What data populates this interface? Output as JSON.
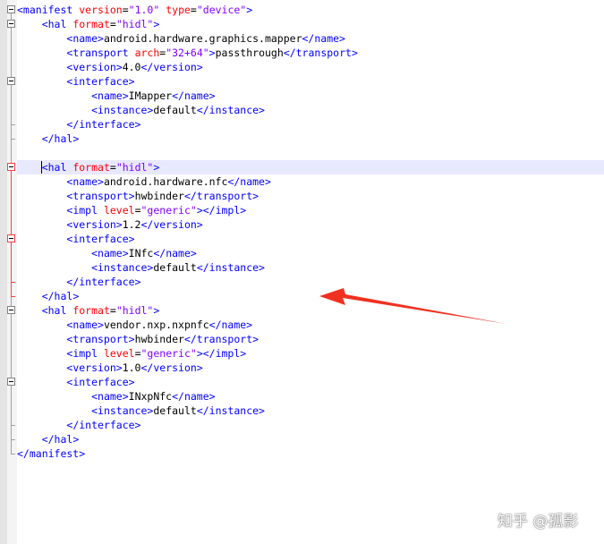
{
  "editor": {
    "lines": [
      {
        "indent": 0,
        "tokens": [
          {
            "t": "tag",
            "v": "<manifest "
          },
          {
            "t": "attr",
            "v": "version"
          },
          {
            "t": "txt",
            "v": "="
          },
          {
            "t": "val",
            "v": "\"1.0\""
          },
          {
            "t": "txt",
            "v": " "
          },
          {
            "t": "attr",
            "v": "type"
          },
          {
            "t": "txt",
            "v": "="
          },
          {
            "t": "val",
            "v": "\"device\""
          },
          {
            "t": "tag",
            "v": ">"
          }
        ]
      },
      {
        "indent": 4,
        "tokens": [
          {
            "t": "tag",
            "v": "<hal "
          },
          {
            "t": "attr",
            "v": "format"
          },
          {
            "t": "txt",
            "v": "="
          },
          {
            "t": "val",
            "v": "\"hidl\""
          },
          {
            "t": "tag",
            "v": ">"
          }
        ]
      },
      {
        "indent": 8,
        "tokens": [
          {
            "t": "tag",
            "v": "<name>"
          },
          {
            "t": "txt",
            "v": "android.hardware.graphics.mapper"
          },
          {
            "t": "tag",
            "v": "</name>"
          }
        ]
      },
      {
        "indent": 8,
        "tokens": [
          {
            "t": "tag",
            "v": "<transport "
          },
          {
            "t": "attr",
            "v": "arch"
          },
          {
            "t": "txt",
            "v": "="
          },
          {
            "t": "val",
            "v": "\"32+64\""
          },
          {
            "t": "tag",
            "v": ">"
          },
          {
            "t": "txt",
            "v": "passthrough"
          },
          {
            "t": "tag",
            "v": "</transport>"
          }
        ]
      },
      {
        "indent": 8,
        "tokens": [
          {
            "t": "tag",
            "v": "<version>"
          },
          {
            "t": "txt",
            "v": "4.0"
          },
          {
            "t": "tag",
            "v": "</version>"
          }
        ]
      },
      {
        "indent": 8,
        "tokens": [
          {
            "t": "tag",
            "v": "<interface>"
          }
        ]
      },
      {
        "indent": 12,
        "tokens": [
          {
            "t": "tag",
            "v": "<name>"
          },
          {
            "t": "txt",
            "v": "IMapper"
          },
          {
            "t": "tag",
            "v": "</name>"
          }
        ]
      },
      {
        "indent": 12,
        "tokens": [
          {
            "t": "tag",
            "v": "<instance>"
          },
          {
            "t": "txt",
            "v": "default"
          },
          {
            "t": "tag",
            "v": "</instance>"
          }
        ]
      },
      {
        "indent": 8,
        "tokens": [
          {
            "t": "tag",
            "v": "</interface>"
          }
        ]
      },
      {
        "indent": 4,
        "tokens": [
          {
            "t": "tag",
            "v": "</hal>"
          }
        ]
      },
      {
        "indent": 0,
        "tokens": []
      },
      {
        "indent": 4,
        "current": true,
        "tokens": [
          {
            "t": "tag",
            "v": "<hal "
          },
          {
            "t": "attr",
            "v": "format"
          },
          {
            "t": "txt",
            "v": "="
          },
          {
            "t": "val",
            "v": "\"hidl\""
          },
          {
            "t": "tag",
            "v": ">"
          }
        ]
      },
      {
        "indent": 8,
        "tokens": [
          {
            "t": "tag",
            "v": "<name>"
          },
          {
            "t": "txt",
            "v": "android.hardware.nfc"
          },
          {
            "t": "tag",
            "v": "</name>"
          }
        ]
      },
      {
        "indent": 8,
        "tokens": [
          {
            "t": "tag",
            "v": "<transport>"
          },
          {
            "t": "txt",
            "v": "hwbinder"
          },
          {
            "t": "tag",
            "v": "</transport>"
          }
        ]
      },
      {
        "indent": 8,
        "tokens": [
          {
            "t": "tag",
            "v": "<impl "
          },
          {
            "t": "attr",
            "v": "level"
          },
          {
            "t": "txt",
            "v": "="
          },
          {
            "t": "val",
            "v": "\"generic\""
          },
          {
            "t": "tag",
            "v": "></impl>"
          }
        ]
      },
      {
        "indent": 8,
        "tokens": [
          {
            "t": "tag",
            "v": "<version>"
          },
          {
            "t": "txt",
            "v": "1.2"
          },
          {
            "t": "tag",
            "v": "</version>"
          }
        ]
      },
      {
        "indent": 8,
        "tokens": [
          {
            "t": "tag",
            "v": "<interface>"
          }
        ]
      },
      {
        "indent": 12,
        "tokens": [
          {
            "t": "tag",
            "v": "<name>"
          },
          {
            "t": "txt",
            "v": "INfc"
          },
          {
            "t": "tag",
            "v": "</name>"
          }
        ]
      },
      {
        "indent": 12,
        "tokens": [
          {
            "t": "tag",
            "v": "<instance>"
          },
          {
            "t": "txt",
            "v": "default"
          },
          {
            "t": "tag",
            "v": "</instance>"
          }
        ]
      },
      {
        "indent": 8,
        "tokens": [
          {
            "t": "tag",
            "v": "</interface>"
          }
        ]
      },
      {
        "indent": 4,
        "tokens": [
          {
            "t": "tag",
            "v": "</hal>"
          }
        ]
      },
      {
        "indent": 4,
        "tokens": [
          {
            "t": "tag",
            "v": "<hal "
          },
          {
            "t": "attr",
            "v": "format"
          },
          {
            "t": "txt",
            "v": "="
          },
          {
            "t": "val",
            "v": "\"hidl\""
          },
          {
            "t": "tag",
            "v": ">"
          }
        ]
      },
      {
        "indent": 8,
        "tokens": [
          {
            "t": "tag",
            "v": "<name>"
          },
          {
            "t": "txt",
            "v": "vendor.nxp.nxpnfc"
          },
          {
            "t": "tag",
            "v": "</name>"
          }
        ]
      },
      {
        "indent": 8,
        "tokens": [
          {
            "t": "tag",
            "v": "<transport>"
          },
          {
            "t": "txt",
            "v": "hwbinder"
          },
          {
            "t": "tag",
            "v": "</transport>"
          }
        ]
      },
      {
        "indent": 8,
        "tokens": [
          {
            "t": "tag",
            "v": "<impl "
          },
          {
            "t": "attr",
            "v": "level"
          },
          {
            "t": "txt",
            "v": "="
          },
          {
            "t": "val",
            "v": "\"generic\""
          },
          {
            "t": "tag",
            "v": "></impl>"
          }
        ]
      },
      {
        "indent": 8,
        "tokens": [
          {
            "t": "tag",
            "v": "<version>"
          },
          {
            "t": "txt",
            "v": "1.0"
          },
          {
            "t": "tag",
            "v": "</version>"
          }
        ]
      },
      {
        "indent": 8,
        "tokens": [
          {
            "t": "tag",
            "v": "<interface>"
          }
        ]
      },
      {
        "indent": 12,
        "tokens": [
          {
            "t": "tag",
            "v": "<name>"
          },
          {
            "t": "txt",
            "v": "INxpNfc"
          },
          {
            "t": "tag",
            "v": "</name>"
          }
        ]
      },
      {
        "indent": 12,
        "tokens": [
          {
            "t": "tag",
            "v": "<instance>"
          },
          {
            "t": "txt",
            "v": "default"
          },
          {
            "t": "tag",
            "v": "</instance>"
          }
        ]
      },
      {
        "indent": 8,
        "tokens": [
          {
            "t": "tag",
            "v": "</interface>"
          }
        ]
      },
      {
        "indent": 4,
        "tokens": [
          {
            "t": "tag",
            "v": "</hal>"
          }
        ]
      },
      {
        "indent": 0,
        "tokens": [
          {
            "t": "tag",
            "v": "</manifest>"
          }
        ]
      }
    ]
  },
  "annotation": {
    "arrow_icon": "red-arrow-icon",
    "color": "#f03020"
  },
  "watermark": {
    "text": "知乎 @孤影"
  },
  "colors": {
    "tag": "#0000ff",
    "attr": "#ff0000",
    "value": "#8000ff",
    "current_line": "#e8e8ff",
    "fold_active": "#ff4040"
  }
}
